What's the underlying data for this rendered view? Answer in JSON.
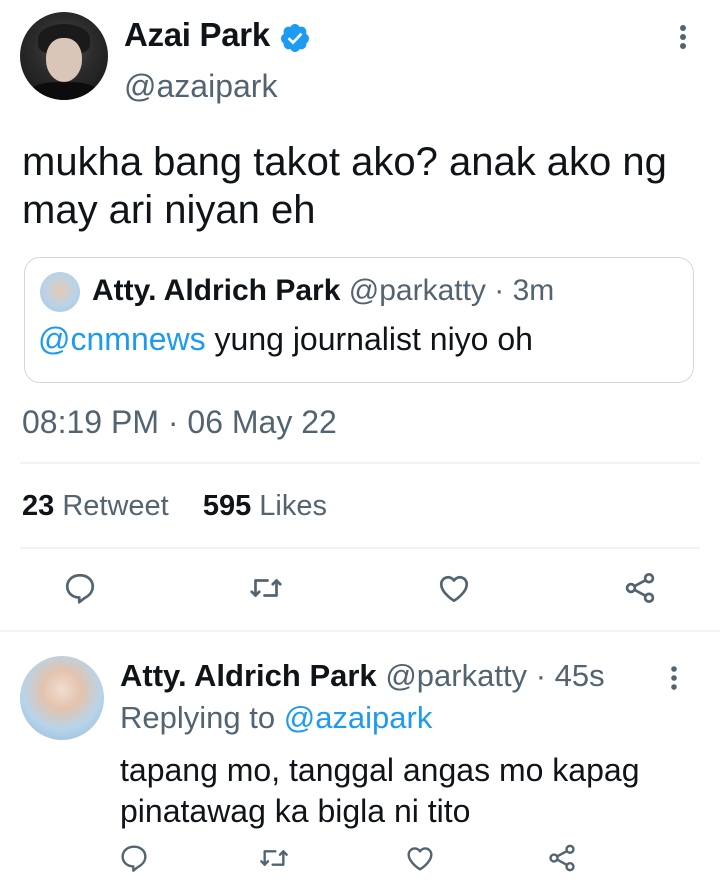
{
  "tweet": {
    "author_name": "Azai Park",
    "author_handle": "@azaipark",
    "text": "mukha bang takot ako? anak ako ng may ari niyan eh",
    "timestamp": "08:19 PM · 06 May 22",
    "retweet_count": "23",
    "retweet_label": "Retweet",
    "likes_count": "595",
    "likes_label": "Likes"
  },
  "quote": {
    "author_name": "Atty. Aldrich Park",
    "author_handle": "@parkatty",
    "time": "· 3m",
    "mention": "@cnmnews",
    "text": " yung journalist niyo oh"
  },
  "reply": {
    "author_name": "Atty. Aldrich Park",
    "author_handle": "@parkatty",
    "time": "· 45s",
    "replying_prefix": "Replying to ",
    "replying_handle": "@azaipark",
    "text": "tapang mo, tanggal angas mo kapag pinatawag ka bigla ni tito"
  },
  "colors": {
    "accent": "#1d9bf0",
    "muted": "#536471",
    "border": "#cfd9de"
  },
  "icons": {
    "verified": "verified-badge-icon",
    "more": "more-vertical-icon",
    "reply": "reply-icon",
    "retweet": "retweet-icon",
    "like": "heart-icon",
    "share": "share-icon"
  }
}
